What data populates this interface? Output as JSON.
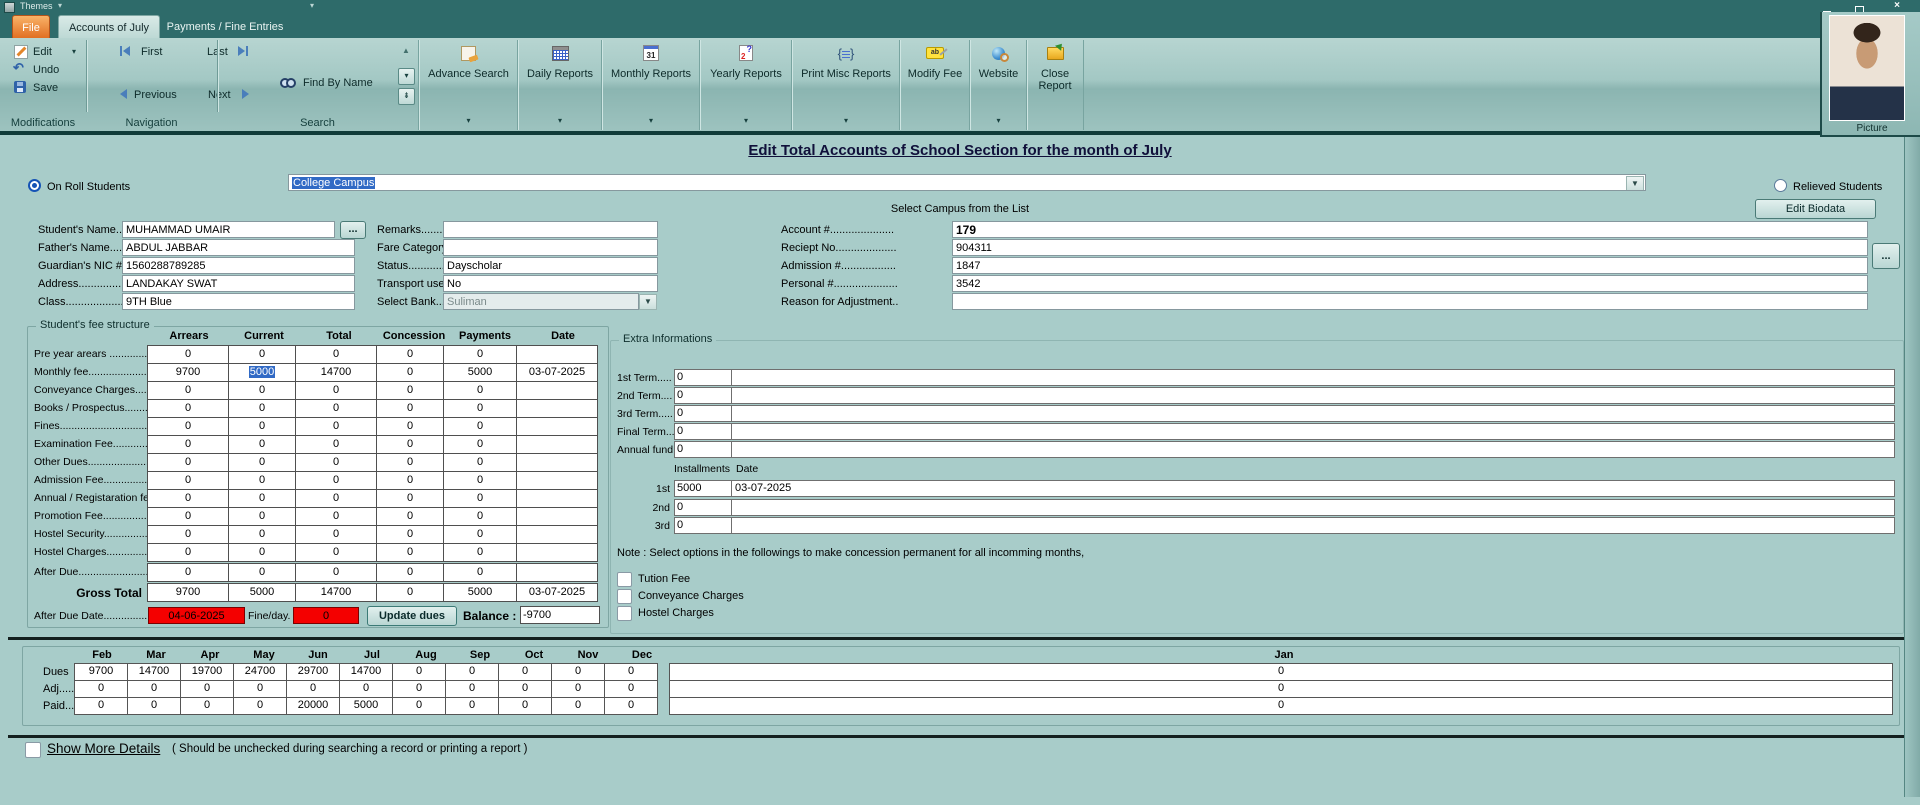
{
  "titlebar": {
    "themes_label": "Themes"
  },
  "tabs": {
    "file": "File",
    "accounts": "Accounts of July",
    "payments": "Payments / Fine Entries"
  },
  "ribbon": {
    "modifications": {
      "group": "Modifications",
      "edit": "Edit",
      "undo": "Undo",
      "save": "Save"
    },
    "navigation": {
      "group": "Navigation",
      "first": "First",
      "last": "Last",
      "previous": "Previous",
      "next": "Next"
    },
    "search": {
      "group": "Search",
      "find_by_name": "Find By Name"
    },
    "big": [
      {
        "label": "Advance Search"
      },
      {
        "label": "Daily Reports"
      },
      {
        "label": "Monthly Reports"
      },
      {
        "label": "Yearly Reports"
      },
      {
        "label": "Print Misc Reports"
      },
      {
        "label": "Modify Fee"
      },
      {
        "label": "Website"
      },
      {
        "label": "Close Report"
      }
    ]
  },
  "picture": {
    "label": "Picture"
  },
  "header": {
    "title": "Edit Total Accounts of School Section for the month of July",
    "on_roll": "On Roll Students",
    "campus": "College Campus",
    "select_campus_hint": "Select Campus from the List",
    "relieved": "Relieved Students",
    "edit_biodata": "Edit Biodata",
    "dots_button": "...",
    "dots_button2": "..."
  },
  "student": {
    "left": [
      {
        "label": "Student's Name......",
        "value": "MUHAMMAD UMAIR"
      },
      {
        "label": "Father's Name........",
        "value": "ABDUL JABBAR"
      },
      {
        "label": "Guardian's NIC #....",
        "value": "1560288789285"
      },
      {
        "label": "Address.................",
        "value": "LANDAKAY SWAT"
      },
      {
        "label": "Class......................",
        "value": "9TH Blue"
      }
    ],
    "mid": [
      {
        "label": "Remarks.........",
        "value": ""
      },
      {
        "label": "Fare Category.",
        "value": ""
      },
      {
        "label": "Status.............",
        "value": "Dayscholar"
      },
      {
        "label": "Transport user",
        "value": "No"
      },
      {
        "label": "Select Bank....",
        "value": "Suliman"
      }
    ],
    "right": [
      {
        "label": "Account #.....................",
        "value": "179"
      },
      {
        "label": "Reciept No....................",
        "value": "904311"
      },
      {
        "label": "Admission #..................",
        "value": "1847"
      },
      {
        "label": "Personal #.....................",
        "value": "3542"
      },
      {
        "label": "Reason for Adjustment..",
        "value": ""
      }
    ]
  },
  "fee": {
    "group_label": "Student's fee structure",
    "columns": [
      "Arrears",
      "Current",
      "Total",
      "Concession",
      "Payments",
      "Date"
    ],
    "rows": [
      {
        "label": "Pre year arears ...............",
        "v": [
          "0",
          "0",
          "0",
          "0",
          "0",
          ""
        ]
      },
      {
        "label": "Monthly fee.......................",
        "v": [
          "9700",
          "5000",
          "14700",
          "0",
          "5000",
          "03-07-2025"
        ]
      },
      {
        "label": "Conveyance Charges.......",
        "v": [
          "0",
          "0",
          "0",
          "0",
          "0",
          ""
        ]
      },
      {
        "label": "Books / Prospectus.........",
        "v": [
          "0",
          "0",
          "0",
          "0",
          "0",
          ""
        ]
      },
      {
        "label": "Fines.................................",
        "v": [
          "0",
          "0",
          "0",
          "0",
          "0",
          ""
        ]
      },
      {
        "label": "Examination Fee...............",
        "v": [
          "0",
          "0",
          "0",
          "0",
          "0",
          ""
        ]
      },
      {
        "label": "Other Dues........................",
        "v": [
          "0",
          "0",
          "0",
          "0",
          "0",
          ""
        ]
      },
      {
        "label": "Admission Fee...................",
        "v": [
          "0",
          "0",
          "0",
          "0",
          "0",
          ""
        ]
      },
      {
        "label": "Annual / Registaration fee",
        "v": [
          "0",
          "0",
          "0",
          "0",
          "0",
          ""
        ]
      },
      {
        "label": "Promotion Fee...................",
        "v": [
          "0",
          "0",
          "0",
          "0",
          "0",
          ""
        ]
      },
      {
        "label": "Hostel Security..................",
        "v": [
          "0",
          "0",
          "0",
          "0",
          "0",
          ""
        ]
      },
      {
        "label": "Hostel Charges..................",
        "v": [
          "0",
          "0",
          "0",
          "0",
          "0",
          ""
        ]
      },
      {
        "label": "After Due...........................",
        "v": [
          "0",
          "0",
          "0",
          "0",
          "0",
          ""
        ]
      }
    ],
    "gross": {
      "label": "Gross Total",
      "v": [
        "9700",
        "5000",
        "14700",
        "0",
        "5000",
        "03-07-2025"
      ]
    },
    "after_due": {
      "label": "After Due Date.................",
      "date": "04-06-2025",
      "fine_label": "Fine/day.",
      "fine": "0",
      "update_btn": "Update dues",
      "balance_label": "Balance :",
      "balance": "-9700"
    }
  },
  "extra": {
    "group_label": "Extra Informations",
    "terms": [
      {
        "label": "1st Term.....",
        "value": "0"
      },
      {
        "label": "2nd Term....",
        "value": "0"
      },
      {
        "label": "3rd Term.....",
        "value": "0"
      },
      {
        "label": "Final Term...",
        "value": "0"
      },
      {
        "label": "Annual fund",
        "value": "0"
      }
    ],
    "inst_headers": [
      "Installments",
      "Date"
    ],
    "installments": [
      {
        "label": "1st",
        "amount": "5000",
        "date": "03-07-2025"
      },
      {
        "label": "2nd",
        "amount": "0",
        "date": ""
      },
      {
        "label": "3rd",
        "amount": "0",
        "date": ""
      }
    ],
    "note": "Note : Select options in the followings to make concession permanent for all incomming months,",
    "checkboxes": [
      "Tution Fee",
      "Conveyance Charges",
      "Hostel Charges"
    ]
  },
  "months": {
    "headers": [
      "Feb",
      "Mar",
      "Apr",
      "May",
      "Jun",
      "Jul",
      "Aug",
      "Sep",
      "Oct",
      "Nov",
      "Dec"
    ],
    "jan": "Jan",
    "rows": [
      {
        "label": "Dues",
        "v": [
          "9700",
          "14700",
          "19700",
          "24700",
          "29700",
          "14700",
          "0",
          "0",
          "0",
          "0",
          "0"
        ],
        "jan": "0"
      },
      {
        "label": "Adj.....",
        "v": [
          "0",
          "0",
          "0",
          "0",
          "0",
          "0",
          "0",
          "0",
          "0",
          "0",
          "0"
        ],
        "jan": "0"
      },
      {
        "label": "Paid...",
        "v": [
          "0",
          "0",
          "0",
          "0",
          "20000",
          "5000",
          "0",
          "0",
          "0",
          "0",
          "0"
        ],
        "jan": "0"
      }
    ]
  },
  "footer": {
    "show_more": "Show More Details",
    "hint": "( Should be unchecked during searching a record or printing a report )"
  }
}
